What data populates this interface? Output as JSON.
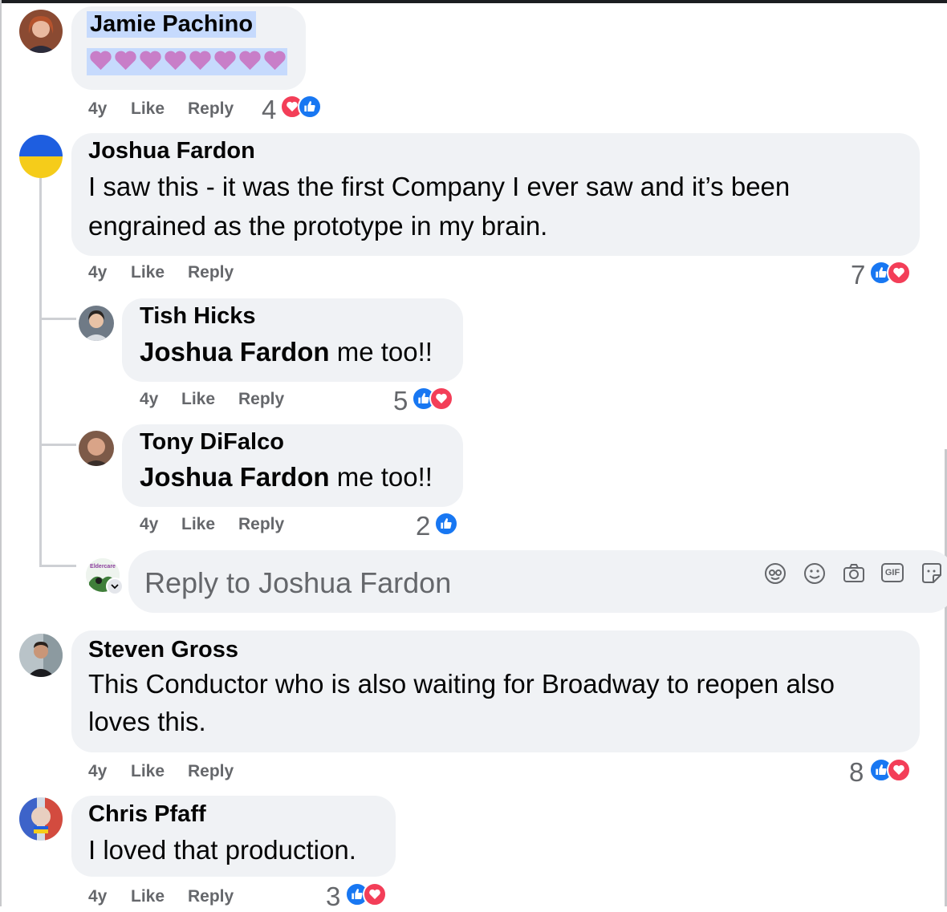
{
  "comments": [
    {
      "name": "Jamie Pachino",
      "body": "💜💜💜💜💜💜💜💜",
      "time": "4y",
      "like": "Like",
      "reply": "Reply",
      "reactions": "4",
      "reaction_icons": [
        "love",
        "like"
      ]
    },
    {
      "name": "Joshua Fardon",
      "body_line1": "I saw this - it was the first Company I ever saw and it’s been",
      "body_line2": "engrained as the prototype in my brain.",
      "time": "4y",
      "like": "Like",
      "reply": "Reply",
      "reactions": "7",
      "reaction_icons": [
        "like",
        "love"
      ],
      "replies": [
        {
          "name": "Tish Hicks",
          "mention": "Joshua Fardon",
          "body": " me too!!",
          "time": "4y",
          "like": "Like",
          "reply": "Reply",
          "reactions": "5",
          "reaction_icons": [
            "like",
            "love"
          ]
        },
        {
          "name": "Tony DiFalco",
          "mention": "Joshua Fardon",
          "body": " me too!!",
          "time": "4y",
          "like": "Like",
          "reply": "Reply",
          "reactions": "2",
          "reaction_icons": [
            "like"
          ]
        }
      ],
      "reply_composer": {
        "placeholder": "Reply to Joshua Fardon",
        "avatar_label": "Eldercare",
        "tools": [
          "avatar-sticker-icon",
          "emoji-icon",
          "camera-icon",
          "gif-icon",
          "sticker-icon"
        ],
        "gif_label": "GIF"
      }
    },
    {
      "name": "Steven Gross",
      "body_line1": "This Conductor who is also waiting for Broadway to reopen also",
      "body_line2": "loves this.",
      "time": "4y",
      "like": "Like",
      "reply": "Reply",
      "reactions": "8",
      "reaction_icons": [
        "like",
        "love"
      ]
    },
    {
      "name": "Chris Pfaff",
      "body": "I loved that production.",
      "time": "4y",
      "like": "Like",
      "reply": "Reply",
      "reactions": "3",
      "reaction_icons": [
        "like",
        "love"
      ]
    }
  ],
  "colors": {
    "like": "#1877f2",
    "love": "#f33e58",
    "bubble": "#f0f2f5",
    "meta": "#65676b",
    "highlight": "#c6dafd"
  }
}
